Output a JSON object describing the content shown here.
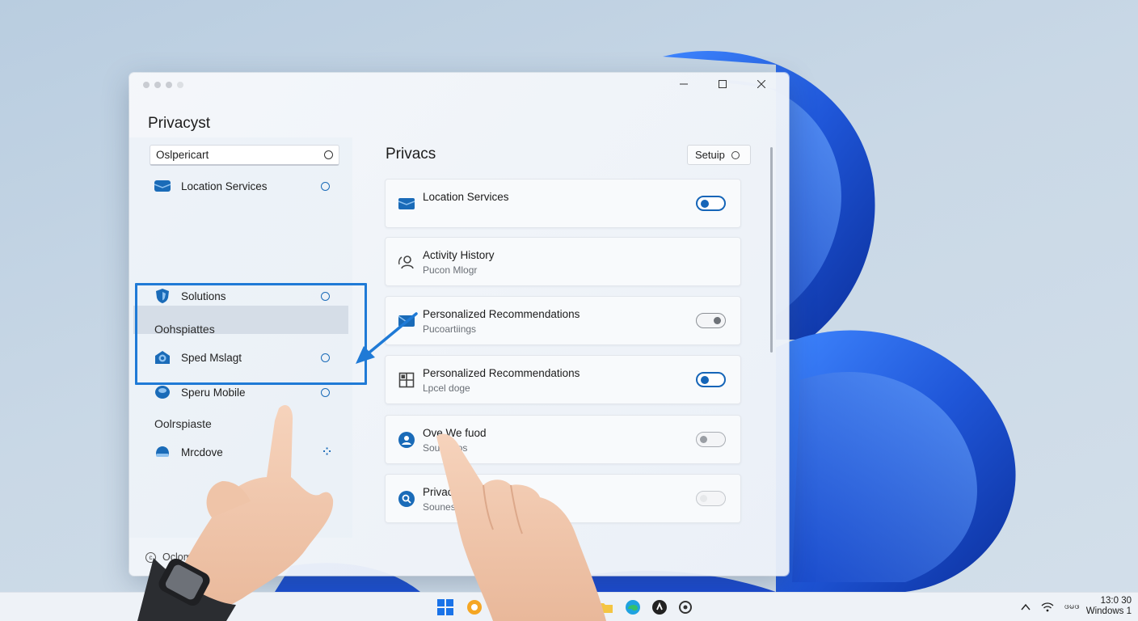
{
  "window": {
    "title": "Privacyst",
    "controls": [
      "minimize-icon",
      "maximize-icon",
      "close-icon"
    ]
  },
  "sidebar": {
    "search": {
      "value": "Oslpericart",
      "placeholder": ""
    },
    "items": [
      {
        "label": "Location Services",
        "icon": "envelope-icon",
        "trailing": "ring"
      },
      {
        "label": "Solutions",
        "icon": "shield-icon",
        "trailing": "ring"
      },
      {
        "label": "Sped Mslagt",
        "icon": "mail-open-icon",
        "trailing": "ring"
      },
      {
        "label": "Speru Mobile",
        "icon": "disc-icon",
        "trailing": "ring"
      },
      {
        "label": "Mrcdove",
        "icon": "cloud-icon",
        "trailing": "dots"
      }
    ],
    "groups": [
      "Oohspiattes",
      "Oolrspiaste"
    ],
    "footer": "Oclomm"
  },
  "main": {
    "title": "Privacs",
    "setup_button": "Setuip",
    "cards": [
      {
        "title": "Location Services",
        "subtitle": "",
        "icon": "envelope-icon",
        "toggle": "on"
      },
      {
        "title": "Activity History",
        "subtitle": "Pucon Mlogr",
        "icon": "activity-person-icon",
        "toggle": "none"
      },
      {
        "title": "Personalized Recommendations",
        "subtitle": "Pucoartiings",
        "icon": "mail-icon",
        "toggle": "off"
      },
      {
        "title": "Personalized Recommendations",
        "subtitle": "Lpcel doge",
        "icon": "grid-icon",
        "toggle": "on"
      },
      {
        "title": "Ove We fuod",
        "subtitle": "Soustiiuos",
        "icon": "person-circle-icon",
        "toggle": "off"
      },
      {
        "title": "Privacy",
        "subtitle": "Sounes",
        "icon": "search-circle-icon",
        "toggle": "off-light"
      }
    ]
  },
  "taskbar": {
    "tray_label": "ဖမဖ",
    "clock_time": "13:0 30",
    "clock_label": "Windows 1"
  },
  "colors": {
    "accent": "#1565b8",
    "selection": "#1f7ad6",
    "wallpaper_blue": "#1f5fe0"
  }
}
